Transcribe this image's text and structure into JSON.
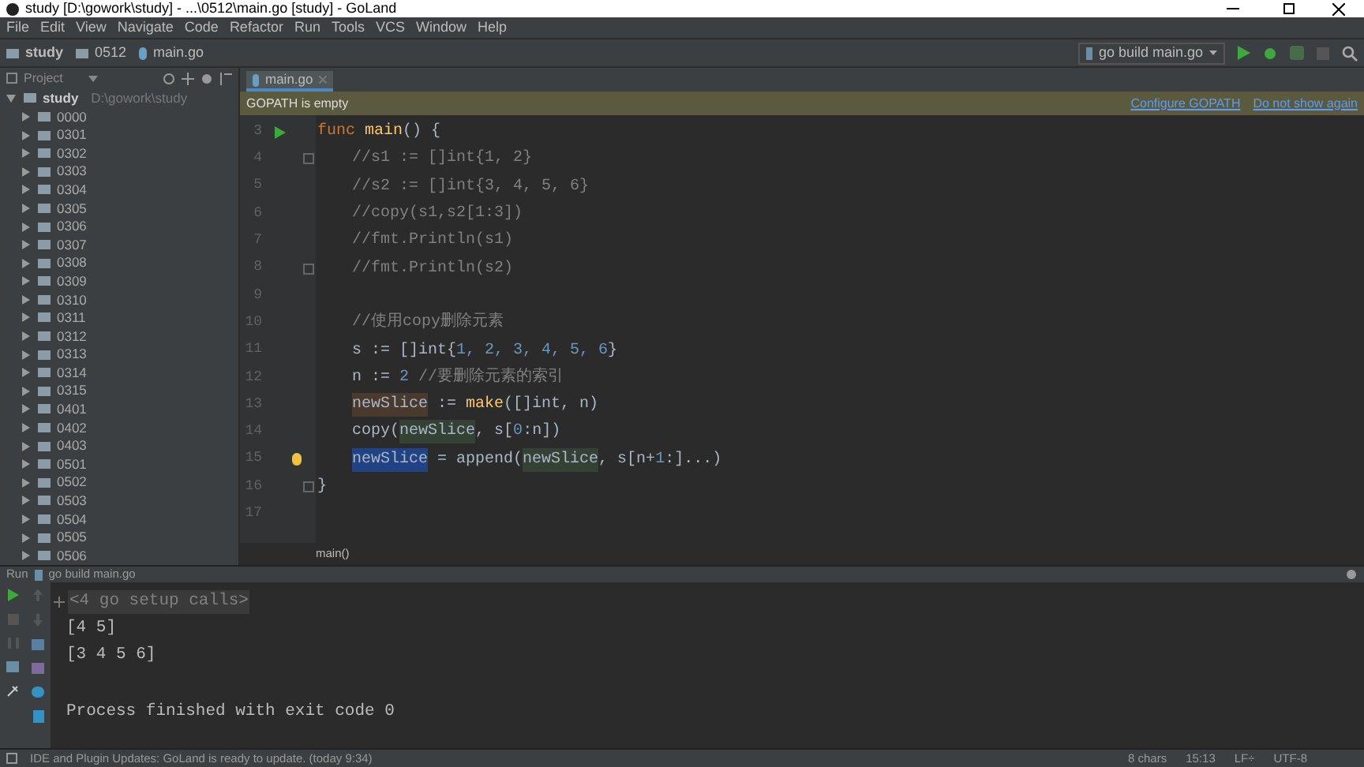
{
  "window": {
    "title": "study [D:\\gowork\\study] - ...\\0512\\main.go [study] - GoLand"
  },
  "menu": [
    "File",
    "Edit",
    "View",
    "Navigate",
    "Code",
    "Refactor",
    "Run",
    "Tools",
    "VCS",
    "Window",
    "Help"
  ],
  "breadcrumbs": [
    {
      "label": "study",
      "kind": "folder"
    },
    {
      "label": "0512",
      "kind": "folder"
    },
    {
      "label": "main.go",
      "kind": "file"
    }
  ],
  "run_config": {
    "label": "go build main.go"
  },
  "project": {
    "title": "Project",
    "root": {
      "label": "study",
      "path": "D:\\gowork\\study",
      "expanded": true,
      "children": [
        {
          "label": "0000",
          "expanded": false
        },
        {
          "label": "0301",
          "expanded": false
        },
        {
          "label": "0302",
          "expanded": false
        },
        {
          "label": "0303",
          "expanded": false
        },
        {
          "label": "0304",
          "expanded": false
        },
        {
          "label": "0305",
          "expanded": false
        },
        {
          "label": "0306",
          "expanded": false
        },
        {
          "label": "0307",
          "expanded": false
        },
        {
          "label": "0308",
          "expanded": false
        },
        {
          "label": "0309",
          "expanded": false
        },
        {
          "label": "0310",
          "expanded": false
        },
        {
          "label": "0311",
          "expanded": false
        },
        {
          "label": "0312",
          "expanded": false
        },
        {
          "label": "0313",
          "expanded": false
        },
        {
          "label": "0314",
          "expanded": false
        },
        {
          "label": "0315",
          "expanded": false
        },
        {
          "label": "0401",
          "expanded": false
        },
        {
          "label": "0402",
          "expanded": false
        },
        {
          "label": "0403",
          "expanded": false
        },
        {
          "label": "0501",
          "expanded": false
        },
        {
          "label": "0502",
          "expanded": false
        },
        {
          "label": "0503",
          "expanded": false
        },
        {
          "label": "0504",
          "expanded": false
        },
        {
          "label": "0505",
          "expanded": false
        },
        {
          "label": "0506",
          "expanded": false
        }
      ]
    }
  },
  "tabs": [
    {
      "label": "main.go",
      "selected": true
    }
  ],
  "banner": {
    "message": "GOPATH is empty",
    "links": [
      "Configure GOPATH",
      "Do not show again"
    ]
  },
  "code": [
    {
      "number": "3",
      "marker": {
        "kind": "run"
      },
      "indented": false,
      "tokens": [
        {
          "kind": "keyword",
          "text": "func"
        },
        {
          "kind": "function",
          "text": "main"
        },
        {
          "kind": "plain",
          "text": "() {"
        }
      ]
    },
    {
      "number": "4",
      "marker": {
        "kind": "fold"
      },
      "indented": true,
      "tokens": [
        {
          "kind": "comment",
          "text": "//s1 := []int{1, 2}"
        }
      ]
    },
    {
      "number": "5",
      "indented": true,
      "tokens": [
        {
          "kind": "comment",
          "text": "//s2 := []int{3, 4, 5, 6}"
        }
      ]
    },
    {
      "number": "6",
      "indented": true,
      "tokens": [
        {
          "kind": "comment",
          "text": "//copy(s1,s2[1:3])"
        }
      ]
    },
    {
      "number": "7",
      "indented": true,
      "tokens": [
        {
          "kind": "comment",
          "text": "//fmt.Println(s1)"
        }
      ]
    },
    {
      "number": "8",
      "marker": {
        "kind": "fold"
      },
      "indented": true,
      "tokens": [
        {
          "kind": "comment",
          "text": "//fmt.Println(s2)"
        }
      ]
    },
    {
      "number": "9"
    },
    {
      "number": "10",
      "indented": true,
      "tokens": [
        {
          "kind": "comment",
          "text": "//使用copy删除元素"
        }
      ]
    },
    {
      "number": "11",
      "indented": true,
      "tokens": [
        {
          "kind": "plain",
          "text": "s := []int{"
        },
        {
          "kind": "number",
          "text": "1, 2, 3, 4, 5, 6"
        },
        {
          "kind": "plain",
          "text": "}"
        }
      ]
    },
    {
      "number": "12",
      "indented": true,
      "tokens": [
        {
          "kind": "plain",
          "text": "n := "
        },
        {
          "kind": "number",
          "text": "2"
        },
        {
          "kind": "comment",
          "text": " //要删除元素的索引"
        }
      ]
    },
    {
      "number": "13",
      "indented": true,
      "tokens": [
        {
          "kind": "write",
          "text": "newSlice"
        },
        {
          "kind": "plain",
          "text": " := "
        },
        {
          "kind": "function",
          "text": "make"
        },
        {
          "kind": "plain",
          "text": "([]int, n)"
        }
      ]
    },
    {
      "number": "14",
      "indented": true,
      "tokens": [
        {
          "kind": "plain",
          "text": "copy("
        },
        {
          "kind": "read",
          "text": "newSlice"
        },
        {
          "kind": "plain",
          "text": ", s["
        },
        {
          "kind": "number",
          "text": "0"
        },
        {
          "kind": "plain",
          "text": ":n])"
        }
      ]
    },
    {
      "number": "15",
      "marker": {
        "kind": "bulb"
      },
      "indented": true,
      "tokens": [
        {
          "kind": "selected",
          "text": "newSlice"
        },
        {
          "kind": "plain",
          "text": " = append("
        },
        {
          "kind": "read",
          "text": "newSlice"
        },
        {
          "kind": "plain",
          "text": ", s[n+"
        },
        {
          "kind": "number",
          "text": "1"
        },
        {
          "kind": "plain",
          "text": ":]...)"
        }
      ]
    },
    {
      "number": "16",
      "marker": {
        "kind": "fold"
      },
      "indented": false,
      "tokens": [
        {
          "kind": "plain",
          "text": "}"
        }
      ]
    },
    {
      "number": "17"
    }
  ],
  "editor_breadcrumb": "main()",
  "run_panel": {
    "label": "Run",
    "config": "go build main.go",
    "output": [
      {
        "kind": "folded",
        "text": "<4 go setup calls>"
      },
      {
        "kind": "plain",
        "text": "[4 5]"
      },
      {
        "kind": "plain",
        "text": "[3 4 5 6]"
      },
      {
        "kind": "gap",
        "text": "Process finished with exit code 0"
      }
    ]
  },
  "status_bar": {
    "message": "IDE and Plugin Updates: GoLand is ready to update. (today 9:34)",
    "items": [
      "8 chars",
      "15:13",
      "LF÷",
      "UTF-8"
    ]
  }
}
